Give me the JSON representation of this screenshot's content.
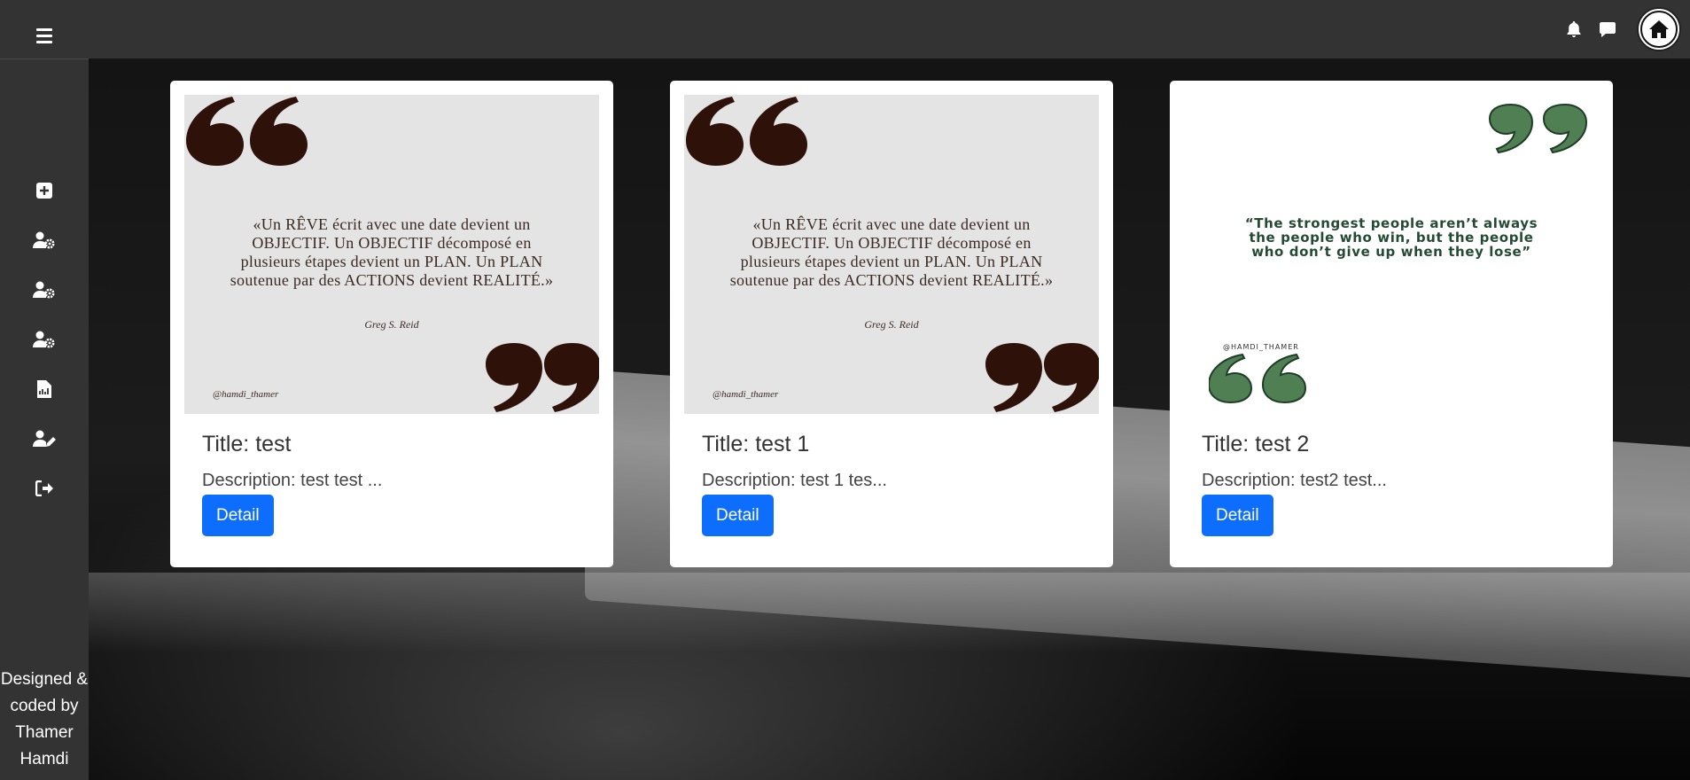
{
  "colors": {
    "topbar": "#333333",
    "sidebar": "#333333",
    "button": "#0d6efd",
    "quote_mark_dark": "#2e120a",
    "quote_mark_green": "#4f7f52"
  },
  "header": {
    "menu_icon": "hamburger-icon",
    "icons": [
      "bell-icon",
      "message-icon",
      "home-icon"
    ]
  },
  "sidebar": {
    "items": [
      {
        "icon": "plus-square-icon"
      },
      {
        "icon": "user-cog-icon"
      },
      {
        "icon": "user-cog-icon"
      },
      {
        "icon": "user-cog-icon"
      },
      {
        "icon": "file-chart-icon"
      },
      {
        "icon": "user-edit-icon"
      },
      {
        "icon": "sign-out-icon"
      }
    ],
    "credit": "Designed & coded by Thamer Hamdi"
  },
  "cards": [
    {
      "title": "Title: test",
      "description": "Description: test test ...",
      "button": "Detail",
      "image": {
        "quote": "«Un RÊVE écrit avec une date devient un OBJECTIF. Un OBJECTIF décomposé en plusieurs étapes devient un PLAN. Un PLAN soutenue par des ACTIONS devient REALITÉ.»",
        "author": "Greg S. Reid",
        "handle": "@hamdi_thamer"
      }
    },
    {
      "title": "Title: test 1",
      "description": "Description: test 1 tes...",
      "button": "Detail",
      "image": {
        "quote": "«Un RÊVE écrit avec une date devient un OBJECTIF. Un OBJECTIF décomposé en plusieurs étapes devient un PLAN. Un PLAN soutenue par des ACTIONS devient REALITÉ.»",
        "author": "Greg S. Reid",
        "handle": "@hamdi_thamer"
      }
    },
    {
      "title": "Title: test 2",
      "description": "Description: test2 test...",
      "button": "Detail",
      "image": {
        "quote": "“The strongest people aren’t always the people who win, but the people who don’t give up when they lose”",
        "handle": "@HAMDI_THAMER"
      }
    }
  ]
}
